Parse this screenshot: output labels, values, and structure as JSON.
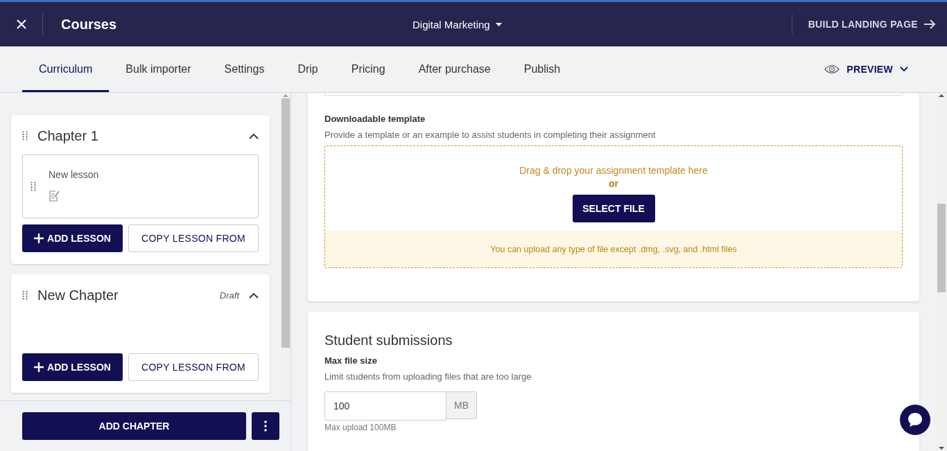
{
  "header": {
    "title": "Courses",
    "course": "Digital Marketing",
    "action": "BUILD LANDING PAGE"
  },
  "tabs": [
    {
      "label": "Curriculum",
      "selected": true
    },
    {
      "label": "Bulk importer",
      "selected": false
    },
    {
      "label": "Settings",
      "selected": false
    },
    {
      "label": "Drip",
      "selected": false
    },
    {
      "label": "Pricing",
      "selected": false
    },
    {
      "label": "After purchase",
      "selected": false
    },
    {
      "label": "Publish",
      "selected": false
    }
  ],
  "preview": "PREVIEW",
  "chapters": [
    {
      "title": "Chapter 1",
      "expanded": true,
      "lessons": [
        {
          "title": "New lesson"
        }
      ],
      "add_label": "ADD LESSON",
      "copy_label": "COPY LESSON FROM"
    },
    {
      "title": "New Chapter",
      "status": "Draft",
      "expanded": true,
      "add_label": "ADD LESSON",
      "copy_label": "COPY LESSON FROM"
    }
  ],
  "add_chapter": "ADD CHAPTER",
  "template": {
    "label": "Downloadable template",
    "help": "Provide a template or an example to assist students in completing their assignment",
    "drop_text": "Drag & drop your assignment template here",
    "or": "or",
    "button": "SELECT FILE",
    "note": "You can upload any type of file except .dmg, .svg, and .html files"
  },
  "submissions": {
    "title": "Student submissions",
    "label": "Max file size",
    "help": "Limit students from uploading files that are too large",
    "value": "100",
    "unit": "MB",
    "hint": "Max upload 100MB"
  }
}
